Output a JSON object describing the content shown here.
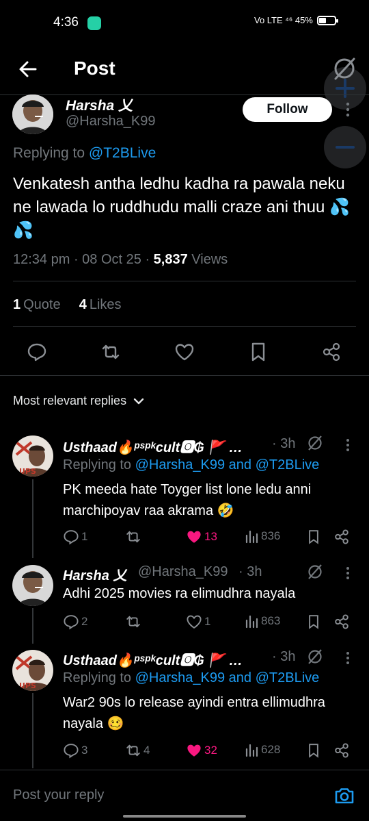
{
  "status": {
    "time": "4:36",
    "right_text": "Vo LTE ⁴⁶ 45%"
  },
  "header": {
    "title": "Post"
  },
  "tweet": {
    "name": "Harsha 乂",
    "handle": "@Harsha_K99",
    "follow_label": "Follow",
    "replying_prefix": "Replying to",
    "replying_to": "@T2BLive",
    "text": "Venkatesh antha ledhu kadha ra pawala neku ne lawada lo ruddhudu malli craze ani thuu 💦💦",
    "time": "12:34 pm",
    "date": "08 Oct 25",
    "views": "5,837",
    "views_label": "Views",
    "quotes": "1",
    "quotes_label": "Quote",
    "likes": "4",
    "likes_label": "Likes"
  },
  "sort": {
    "label": "Most relevant replies"
  },
  "replies": [
    {
      "name": "Usthaad🔥ᵖˢᵖᵏcult🅾₲ 🚩 …",
      "time": "· 3h",
      "replying_prefix": "Replying to",
      "replying_to": "@Harsha_K99 and @T2BLive",
      "text": "PK meeda hate Toyger list lone ledu anni marchipoyav raa akrama 🤣",
      "replies": "1",
      "retweets": "",
      "likes": "13",
      "views": "836",
      "liked": true
    },
    {
      "name": "Harsha 乂",
      "handle": "@Harsha_K99",
      "time": "· 3h",
      "text": "Adhi 2025 movies ra elimudhra nayala",
      "replies": "2",
      "retweets": "",
      "likes": "1",
      "views": "863",
      "liked": false
    },
    {
      "name": "Usthaad🔥ᵖˢᵖᵏcult🅾₲ 🚩 …",
      "time": "· 3h",
      "replying_prefix": "Replying to",
      "replying_to": "@Harsha_K99 and @T2BLive",
      "text": "War2 90s lo release ayindi entra ellimudhra nayala 🥴",
      "replies": "3",
      "retweets": "4",
      "likes": "32",
      "views": "628",
      "liked": true
    }
  ],
  "composer": {
    "placeholder": "Post your reply"
  },
  "colors": {
    "accent": "#1d9bf0",
    "like": "#f91880",
    "muted": "#71767b"
  }
}
